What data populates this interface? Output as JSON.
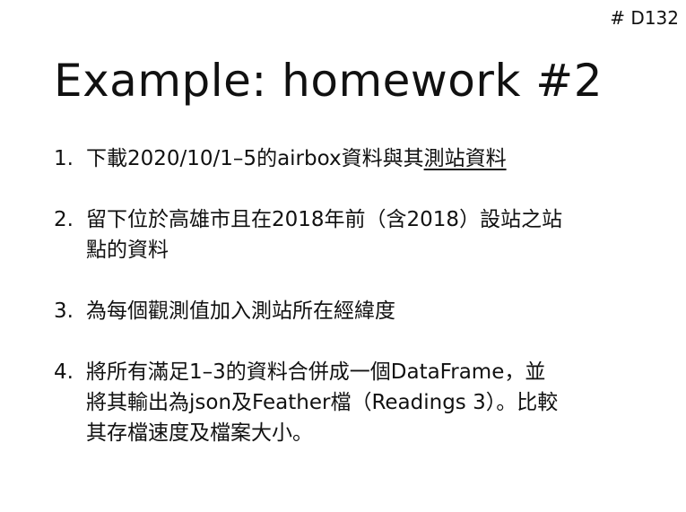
{
  "slide": {
    "number": "# D132",
    "title": "Example: homework #2"
  },
  "items": [
    {
      "num": "1.",
      "lines": [
        {
          "text": "下載2020/10/1–5的airbox資料與其",
          "link": "測站資料"
        }
      ]
    },
    {
      "num": "2.",
      "lines": [
        {
          "text": "留下位於高雄市且在2018年前（含2018）設站之站"
        },
        {
          "text": "點的資料"
        }
      ]
    },
    {
      "num": "3.",
      "lines": [
        {
          "text": "為每個觀測值加入測站所在經緯度"
        }
      ]
    },
    {
      "num": "4.",
      "lines": [
        {
          "text": "將所有滿足1–3的資料合併成一個DataFrame，並"
        },
        {
          "text": "將其輸出為json及Feather檔（Readings 3）。比較"
        },
        {
          "text": "其存檔速度及檔案大小。"
        }
      ]
    }
  ]
}
